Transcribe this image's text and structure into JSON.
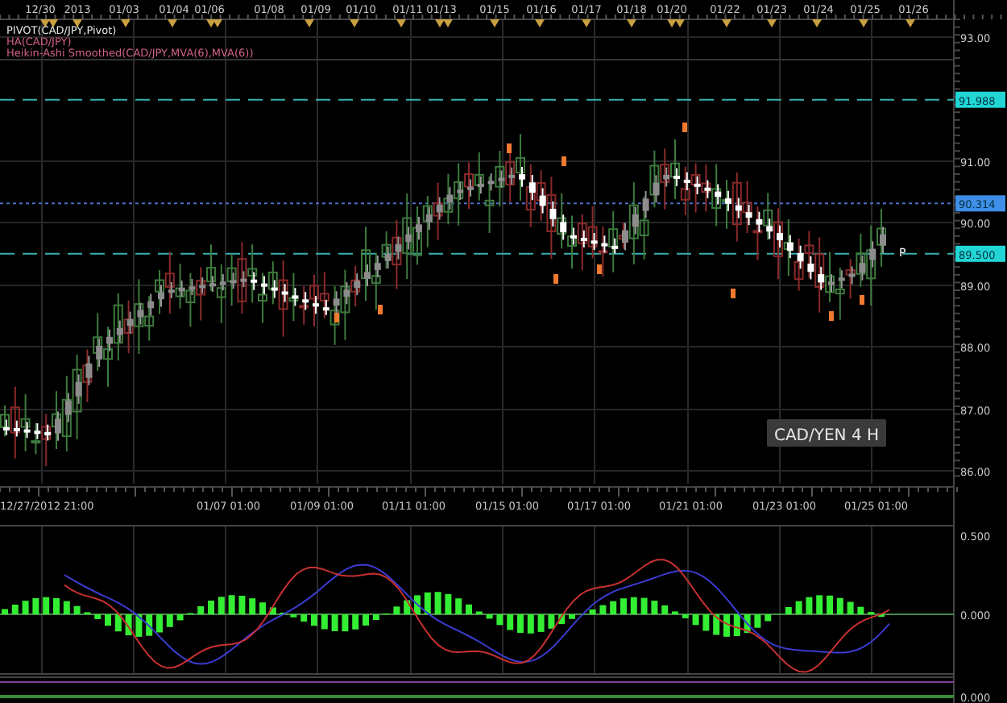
{
  "top_axis": {
    "labels": [
      "12/30",
      "2013",
      "01/03",
      "01/04",
      "01/06",
      "01/08",
      "01/09",
      "01/10",
      "01/11",
      "01/13",
      "01/15",
      "01/16",
      "01/17",
      "01/18",
      "01/20",
      "01/22",
      "01/23",
      "01/24",
      "01/25",
      "01/26"
    ]
  },
  "legend": [
    {
      "text": "PIVOT(CAD/JPY,Pivot)",
      "color": "#e8e8e8"
    },
    {
      "text": "HA(CAD/JPY)",
      "color": "#d0608a"
    },
    {
      "text": "Heikin-Ashi Smoothed(CAD/JPY,MVA(6),MVA(6))",
      "color": "#d0608a"
    }
  ],
  "price_axis": {
    "ticks": [
      "93.00",
      "91.00",
      "90.00",
      "89.00",
      "88.00",
      "87.00",
      "86.00"
    ]
  },
  "price_tags": [
    {
      "text": "91.988",
      "kind": "pivot"
    },
    {
      "text": "90.314",
      "kind": "last"
    },
    {
      "text": "89.500",
      "kind": "pivot"
    }
  ],
  "pivot_marker": "P",
  "chart_label": "CAD/YEN 4 H",
  "time_axis": {
    "labels": [
      "12/27/2012 21:00",
      "01/07 01:00",
      "01/09 01:00",
      "01/11 01:00",
      "01/15 01:00",
      "01/17 01:00",
      "01/21 01:00",
      "01/23 01:00",
      "01/25 01:00"
    ]
  },
  "oscillator_axis": {
    "ticks": [
      "0.500",
      "0.000"
    ]
  },
  "volume_axis": {
    "ticks": [
      "0.000"
    ]
  }
}
